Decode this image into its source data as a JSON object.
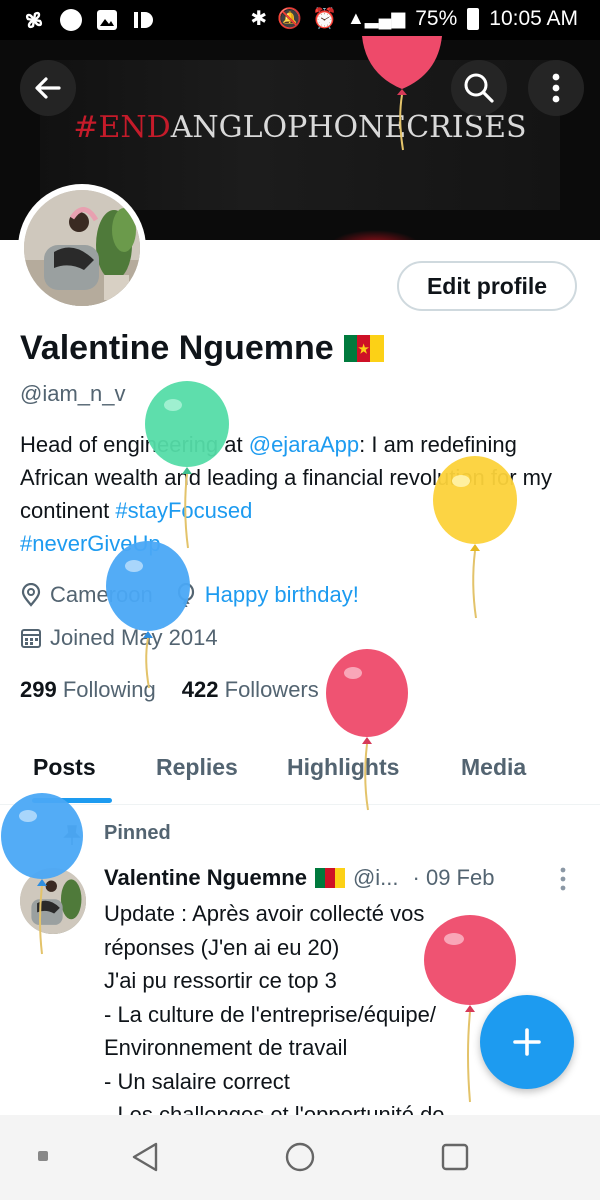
{
  "status_bar": {
    "battery": "75%",
    "time": "10:05 AM"
  },
  "banner": {
    "text_red": "#END",
    "text_white": "ANGLOPHONECRISES"
  },
  "profile": {
    "edit_label": "Edit profile",
    "name": "Valentine Nguemne",
    "handle": "@iam_n_v",
    "bio_1": "Head of engineering at ",
    "bio_mention": "@ejaraApp",
    "bio_2": ":  I am redefining African wealth and leading a financial revolution for my continent  ",
    "bio_tag1": "#stayFocused",
    "bio_tag2": "#neverGiveUp",
    "location": "Cameroon",
    "birthday": "Happy birthday!",
    "joined": "Joined May 2014",
    "following_count": "299",
    "following_label": "Following",
    "followers_count": "422",
    "followers_label": "Followers"
  },
  "tabs": [
    "Posts",
    "Replies",
    "Highlights",
    "Media"
  ],
  "post": {
    "pinned_label": "Pinned",
    "author": "Valentine Nguemne",
    "handle": "@i...",
    "date": "· 09 Feb",
    "body": "Update : Après avoir collecté vos\nréponses (J'en ai eu 20)\nJ'ai pu ressortir ce top 3\n- La culture de l'entreprise/équipe/\nEnvironnement de travail\n- Un salaire correct\n- Les challenges et l'opportunité de"
  },
  "colors": {
    "accent": "#1d9bf0",
    "flag_green": "#007a3d",
    "flag_red": "#ce1126",
    "flag_yellow": "#fcd116"
  },
  "icons": [
    "back-arrow-icon",
    "search-icon",
    "more-vertical-icon",
    "location-pin-icon",
    "balloon-icon",
    "calendar-icon",
    "pin-icon",
    "compose-plus-icon",
    "nav-back-icon",
    "nav-home-icon",
    "nav-recents-icon"
  ]
}
